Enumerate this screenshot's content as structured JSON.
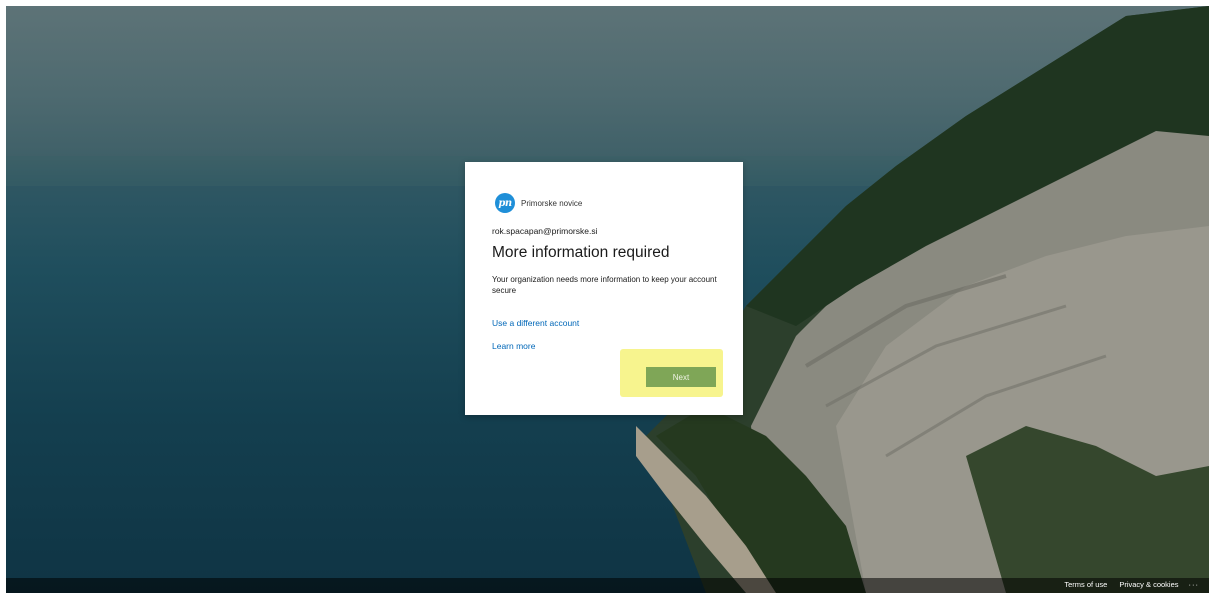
{
  "brand": {
    "logo_text": "pn",
    "name": "Primorske novice",
    "logo_color": "#1f8fd8"
  },
  "signin": {
    "identity": "rok.spacapan@primorske.si",
    "title": "More information required",
    "description": "Your organization needs more information to keep your account secure",
    "use_different_account": "Use a different account",
    "learn_more": "Learn more",
    "next_label": "Next",
    "next_button_color": "#7fa657",
    "highlight_color": "#f6f27a"
  },
  "footer": {
    "terms": "Terms of use",
    "privacy": "Privacy & cookies",
    "more": "···"
  }
}
